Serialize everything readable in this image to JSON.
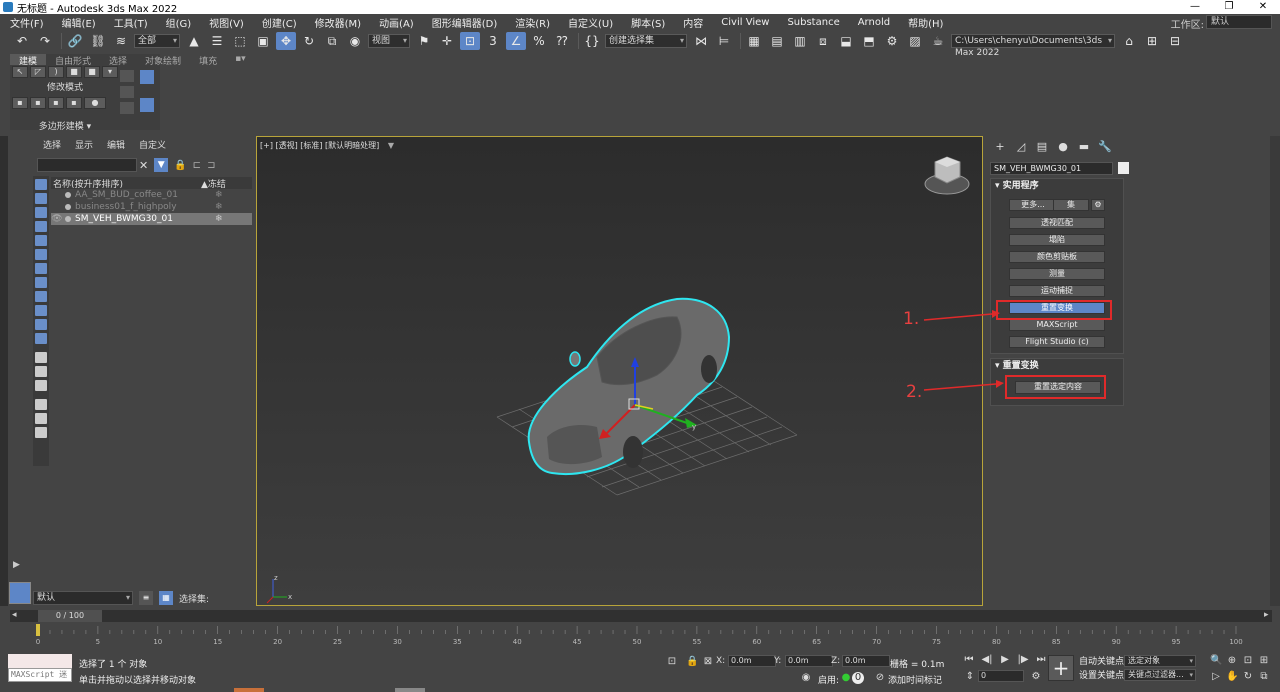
{
  "window": {
    "title": "无标题 - Autodesk 3ds Max 2022",
    "controls": [
      "—",
      "❐",
      "✕"
    ]
  },
  "menu": {
    "items": [
      "文件(F)",
      "编辑(E)",
      "工具(T)",
      "组(G)",
      "视图(V)",
      "创建(C)",
      "修改器(M)",
      "动画(A)",
      "图形编辑器(D)",
      "渲染(R)",
      "自定义(U)",
      "脚本(S)",
      "内容",
      "Civil View",
      "Substance",
      "Arnold",
      "帮助(H)"
    ],
    "workspace_label": "工作区:",
    "workspace_value": "默认"
  },
  "toolbar": {
    "filter_dropdown": "全部",
    "refcoord_dropdown": "视图",
    "selection_set_dropdown": "创建选择集",
    "project_path": "C:\\Users\\chenyu\\Documents\\3ds Max 2022",
    "snap_number": "3"
  },
  "ribbon": {
    "tabs": [
      "建模",
      "自由形式",
      "选择",
      "对象绘制",
      "填充"
    ],
    "modify_mode_label": "修改模式",
    "footer_label": "多边形建模 ▾"
  },
  "scene_explorer": {
    "menu": [
      "选择",
      "显示",
      "编辑",
      "自定义"
    ],
    "column_name": "名称(按升序排序)",
    "column_freeze": "▲冻结",
    "rows": [
      {
        "name": "AA_SM_BUD_coffee_01",
        "selected": false,
        "visible": false
      },
      {
        "name": "business01_f_highpoly",
        "selected": false,
        "visible": false
      },
      {
        "name": "SM_VEH_BWMG30_01",
        "selected": true,
        "visible": true
      }
    ],
    "layer_dropdown": "默认",
    "selection_set_label": "选择集:"
  },
  "viewport": {
    "label": "[+] [透视] [标准] [默认明暗处理]",
    "filter_icon": "▼",
    "axis_labels": {
      "x": "x",
      "y": "y",
      "z": "z"
    }
  },
  "command_panel": {
    "object_name": "SM_VEH_BWMG30_01",
    "utilities_title": "实用程序",
    "more_button": "更多...",
    "sets_button": "集",
    "utilities": [
      "透视匹配",
      "塌陷",
      "颜色剪贴板",
      "测量",
      "运动捕捉",
      "重置变换",
      "MAXScript",
      "Flight Studio (c)"
    ],
    "active_utility": "重置变换",
    "reset_xform_title": "重置变换",
    "reset_selected_button": "重置选定内容"
  },
  "annotations": {
    "label_1": "1.",
    "label_2": "2."
  },
  "timeline": {
    "frame_display": "0 / 100",
    "ticks": [
      "0",
      "5",
      "10",
      "15",
      "20",
      "25",
      "30",
      "35",
      "40",
      "45",
      "50",
      "55",
      "60",
      "65",
      "70",
      "75",
      "80",
      "85",
      "90",
      "95",
      "100"
    ]
  },
  "status": {
    "maxscript_label": "MAXScript 迷",
    "line1": "选择了 1 个 对象",
    "line2": "单击并拖动以选择并移动对象",
    "x_label": "X:",
    "x_value": "0.0m",
    "y_label": "Y:",
    "y_value": "0.0m",
    "z_label": "Z:",
    "z_value": "0.0m",
    "grid_label": "栅格 = 0.1m",
    "enable_label": "启用:",
    "add_time_tag": "添加时间标记",
    "current_frame": "0",
    "auto_key": "自动关键点",
    "set_key": "设置关键点",
    "selected_object": "选定对象",
    "key_filter": "关键点过滤器..."
  }
}
